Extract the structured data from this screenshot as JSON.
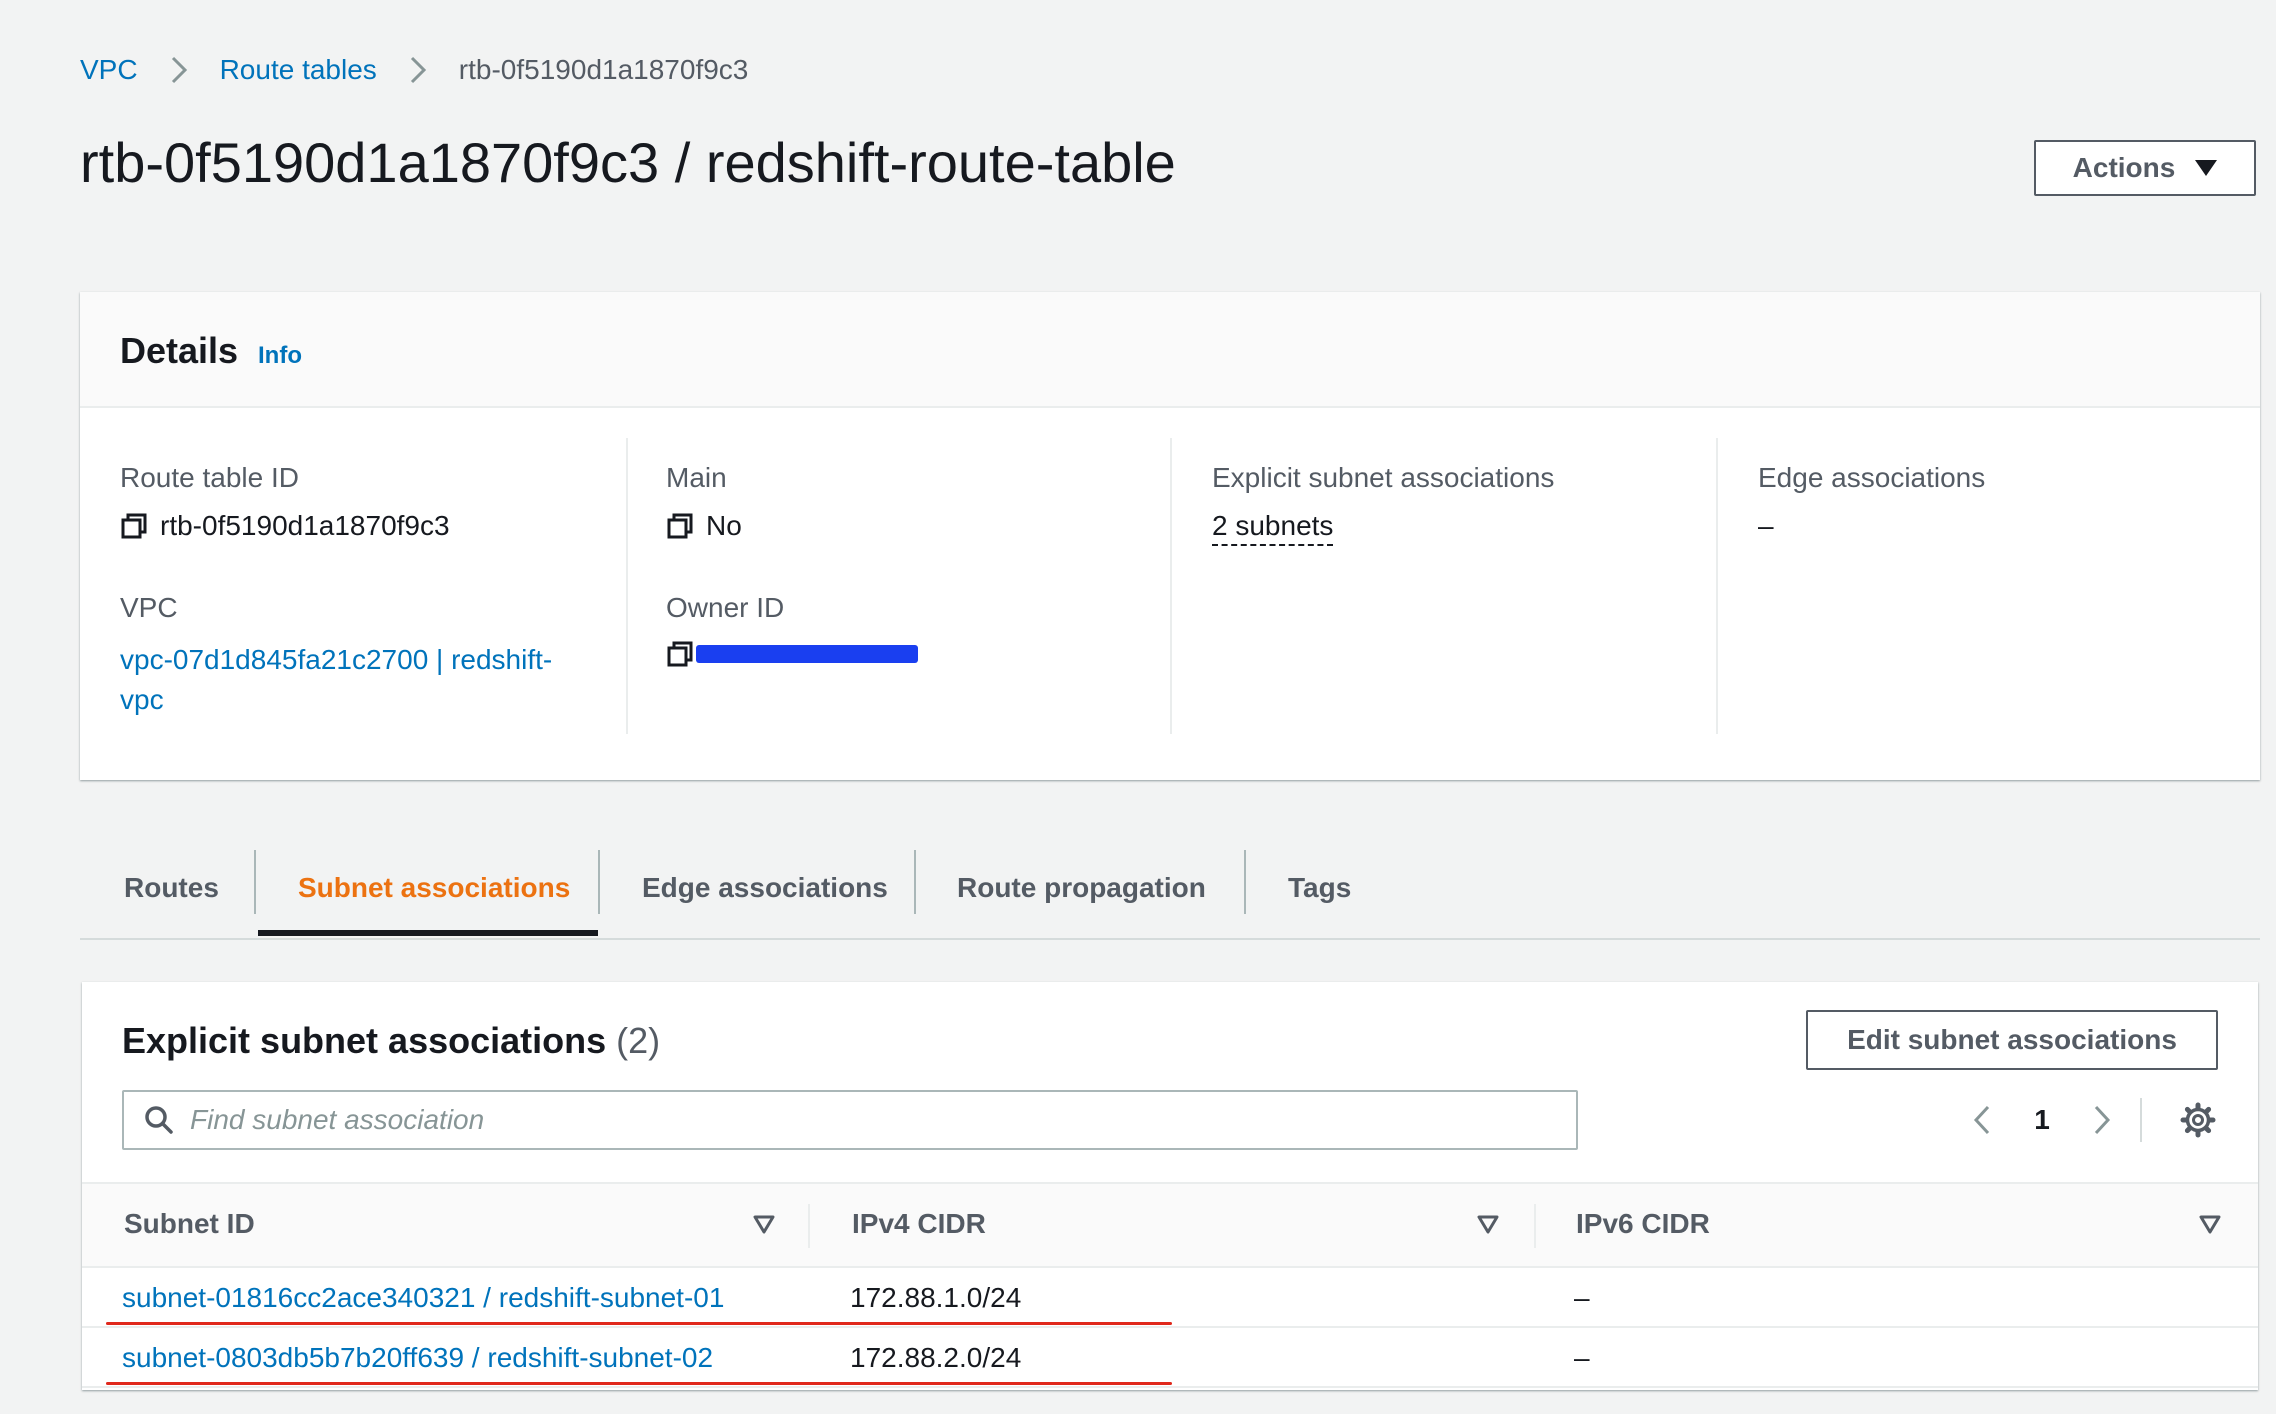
{
  "breadcrumb": {
    "items": [
      "VPC",
      "Route tables"
    ],
    "current": "rtb-0f5190d1a1870f9c3"
  },
  "page_title": "rtb-0f5190d1a1870f9c3 / redshift-route-table",
  "actions_label": "Actions",
  "details": {
    "title": "Details",
    "info": "Info",
    "route_table_id_label": "Route table ID",
    "route_table_id": "rtb-0f5190d1a1870f9c3",
    "vpc_label": "VPC",
    "vpc_line1": "vpc-07d1d845fa21c2700 | redshift-",
    "vpc_line2": "vpc",
    "main_label": "Main",
    "main_value": "No",
    "owner_id_label": "Owner ID",
    "explicit_label": "Explicit subnet associations",
    "explicit_value": "2 subnets",
    "edge_label": "Edge associations",
    "edge_value": "–"
  },
  "tabs": [
    "Routes",
    "Subnet associations",
    "Edge associations",
    "Route propagation",
    "Tags"
  ],
  "active_tab": "Subnet associations",
  "subnet_section": {
    "title": "Explicit subnet associations",
    "count": "(2)",
    "edit_button": "Edit subnet associations",
    "search_placeholder": "Find subnet association",
    "page": "1",
    "columns": [
      "Subnet ID",
      "IPv4 CIDR",
      "IPv6 CIDR"
    ],
    "rows": [
      {
        "subnet": "subnet-01816cc2ace340321 / redshift-subnet-01",
        "ipv4": "172.88.1.0/24",
        "ipv6": "–"
      },
      {
        "subnet": "subnet-0803db5b7b20ff639 / redshift-subnet-02",
        "ipv4": "172.88.2.0/24",
        "ipv6": "–"
      }
    ]
  },
  "colors": {
    "link": "#0073bb",
    "active_tab": "#ec7211",
    "annotation_underline": "#e0281c",
    "redaction": "#1a3ff0"
  }
}
